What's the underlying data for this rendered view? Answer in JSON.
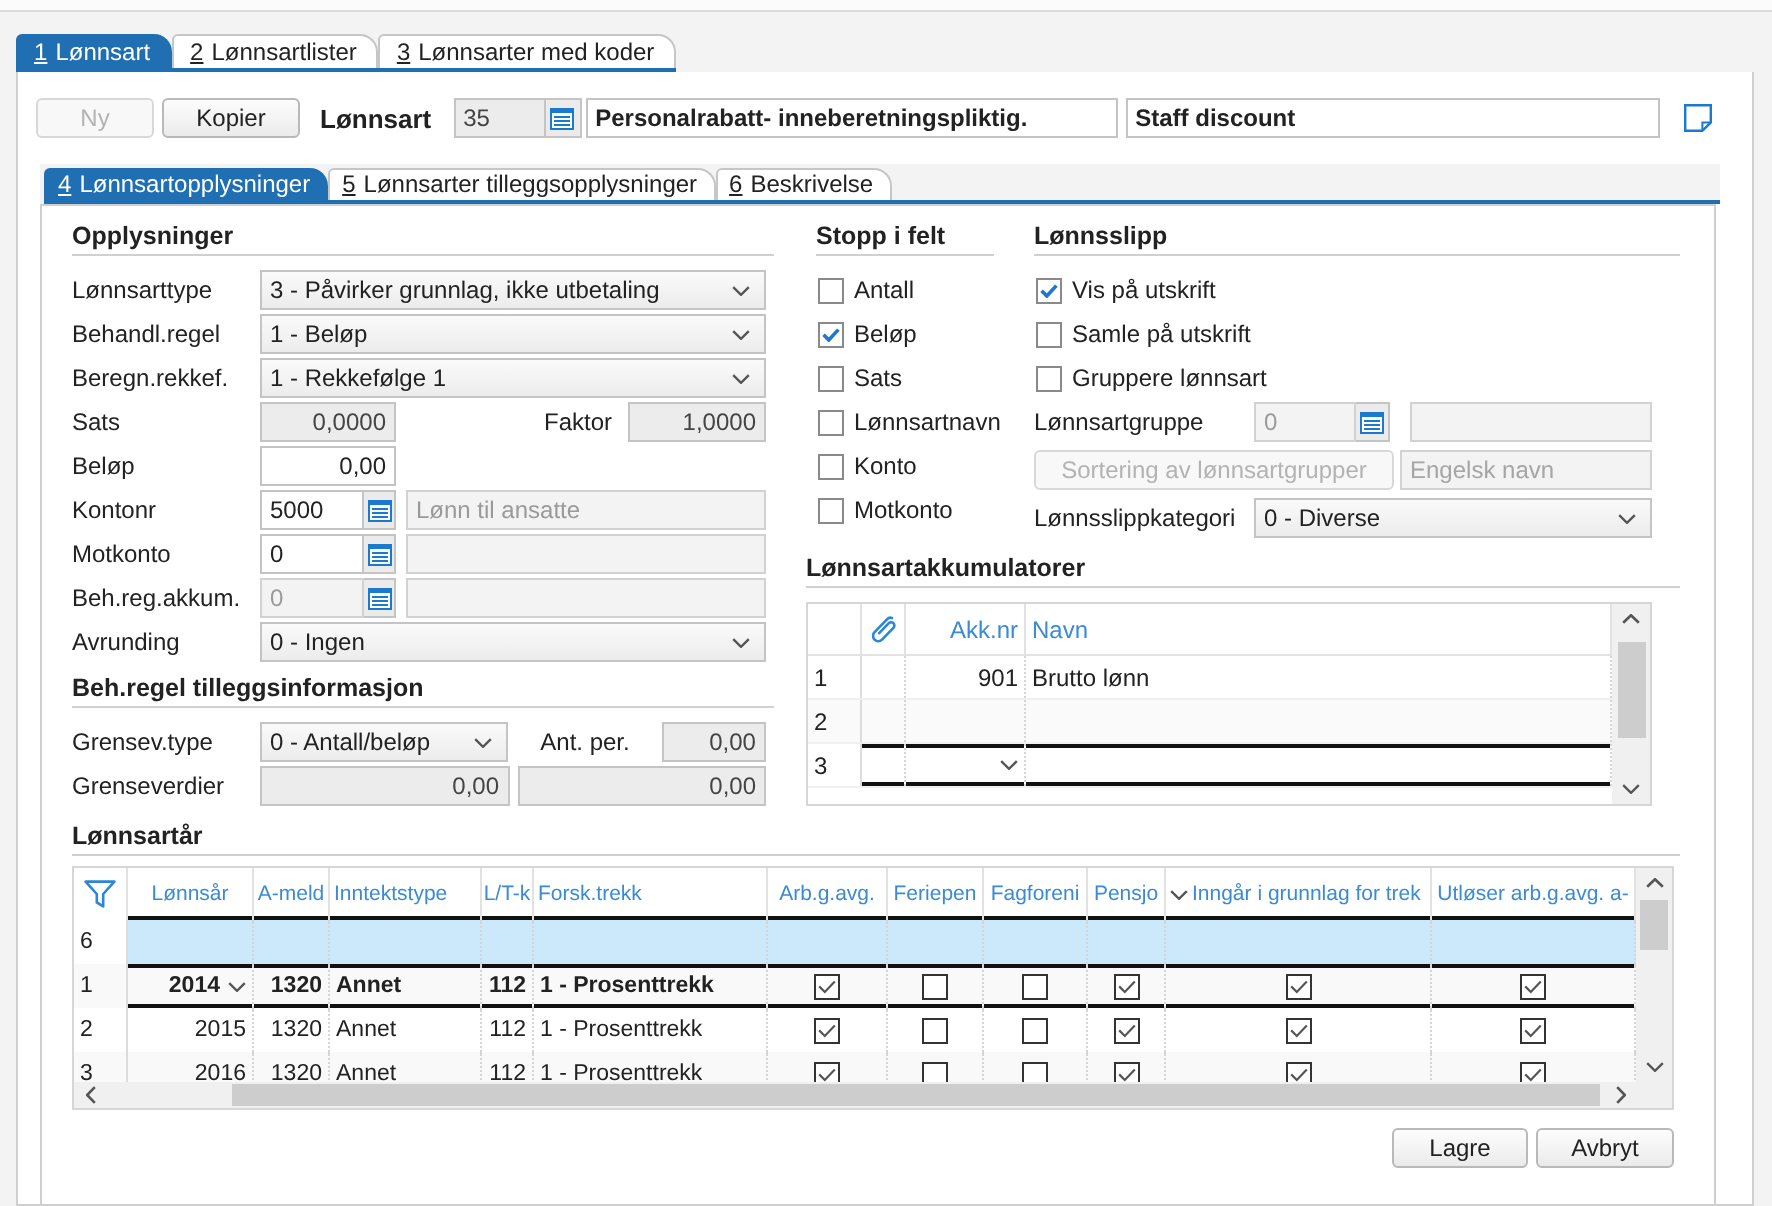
{
  "main_tabs": [
    {
      "key": "1",
      "label": "Lønnsart",
      "selected": true
    },
    {
      "key": "2",
      "label": "Lønnsartlister",
      "selected": false
    },
    {
      "key": "3",
      "label": "Lønnsarter med koder",
      "selected": false
    }
  ],
  "header": {
    "buttons": [
      {
        "label": "Ny",
        "disabled": true
      },
      {
        "label": "Kopier",
        "disabled": false
      }
    ],
    "label": "Lønnsart",
    "fields": [
      {
        "kind": "lookup",
        "value": "35",
        "readonly": true,
        "disabled": false
      },
      {
        "kind": "text",
        "value": "Personalrabatt- inneberetningspliktig.",
        "readonly": false,
        "disabled": false
      },
      {
        "kind": "text",
        "value": "Staff discount",
        "readonly": false,
        "disabled": false
      }
    ]
  },
  "sub_tabs": [
    {
      "key": "4",
      "label": "Lønnsartopplysninger",
      "selected": true
    },
    {
      "key": "5",
      "label": "Lønnsarter tilleggsopplysninger",
      "selected": false
    },
    {
      "key": "6",
      "label": "Beskrivelse",
      "selected": false
    }
  ],
  "sections": [
    {
      "title": "Opplysninger",
      "rows": [
        {
          "label": "Lønnsarttype",
          "controls": [
            {
              "kind": "select",
              "value": "3 - Påvirker grunnlag, ikke utbetaling"
            }
          ]
        },
        {
          "label": "Behandl.regel",
          "controls": [
            {
              "kind": "select",
              "value": "1 - Beløp"
            }
          ]
        },
        {
          "label": "Beregn.rekkef.",
          "controls": [
            {
              "kind": "select",
              "value": "1 - Rekkefølge 1"
            }
          ]
        },
        {
          "label": "Sats",
          "controls": [
            {
              "kind": "number",
              "value": "0,0000",
              "readonly": true,
              "disabled": false
            },
            {
              "kind": "label",
              "text": "Faktor"
            },
            {
              "kind": "number",
              "value": "1,0000",
              "readonly": true,
              "disabled": false
            }
          ]
        },
        {
          "label": "Beløp",
          "controls": [
            {
              "kind": "number",
              "value": "0,00",
              "readonly": false,
              "disabled": false
            }
          ]
        },
        {
          "label": "Kontonr",
          "controls": [
            {
              "kind": "lookup",
              "value": "5000",
              "readonly": false,
              "disabled": false
            },
            {
              "kind": "text",
              "value": "Lønn til ansatte",
              "readonly": false,
              "disabled": true
            }
          ]
        },
        {
          "label": "Motkonto",
          "controls": [
            {
              "kind": "lookup",
              "value": "0",
              "readonly": false,
              "disabled": false
            },
            {
              "kind": "text",
              "readonly": false,
              "disabled": true
            }
          ]
        },
        {
          "label": "Beh.reg.akkum.",
          "controls": [
            {
              "kind": "lookup",
              "value": "0",
              "readonly": false,
              "disabled": true
            },
            {
              "kind": "text",
              "readonly": false,
              "disabled": true
            }
          ]
        },
        {
          "label": "Avrunding",
          "controls": [
            {
              "kind": "select",
              "value": "0 - Ingen"
            }
          ]
        }
      ]
    },
    {
      "title": "Beh.regel tilleggsinformasjon",
      "rows": [
        {
          "label": "Grensev.type",
          "controls": [
            {
              "kind": "select",
              "value": "0 - Antall/beløp"
            },
            {
              "kind": "label",
              "text": "Ant. per."
            },
            {
              "kind": "number",
              "value": "0,00",
              "readonly": true,
              "disabled": false
            }
          ]
        },
        {
          "label": "Grenseverdier",
          "controls": [
            {
              "kind": "number",
              "value": "0,00",
              "readonly": true,
              "disabled": false
            },
            {
              "kind": "number",
              "value": "0,00",
              "readonly": true,
              "disabled": false
            }
          ]
        }
      ]
    }
  ],
  "stop_fields": {
    "title": "Stopp i felt",
    "items": [
      {
        "label": "Antall",
        "checked": false
      },
      {
        "label": "Beløp",
        "checked": true
      },
      {
        "label": "Sats",
        "checked": false
      },
      {
        "label": "Lønnsartnavn",
        "checked": false
      },
      {
        "label": "Konto",
        "checked": false
      },
      {
        "label": "Motkonto",
        "checked": false
      }
    ]
  },
  "payslip": {
    "title": "Lønnsslipp",
    "checkboxes": [
      {
        "label": "Vis på utskrift",
        "checked": true
      },
      {
        "label": "Samle på utskrift",
        "checked": false
      },
      {
        "label": "Gruppere lønnsart",
        "checked": false
      }
    ],
    "rows": [
      {
        "label": "Lønnsartgruppe",
        "controls": [
          {
            "kind": "lookup",
            "value": "0",
            "readonly": false,
            "disabled": true
          },
          {
            "kind": "text",
            "readonly": false,
            "disabled": true
          }
        ]
      },
      {
        "controls": [
          {
            "kind": "button",
            "label": "Sortering av lønnsartgrupper",
            "disabled": true
          },
          {
            "kind": "text",
            "placeholder": "Engelsk navn",
            "readonly": false,
            "disabled": true
          }
        ]
      },
      {
        "label": "Lønnsslippkategori",
        "controls": [
          {
            "kind": "select",
            "value": "0 - Diverse"
          }
        ]
      }
    ]
  },
  "accumulators": {
    "title": "Lønnsartakkumulatorer",
    "columns": [
      {
        "kind": "attachment"
      },
      {
        "kind": "number",
        "label": "Akk.nr"
      },
      {
        "kind": "text",
        "label": "Navn"
      }
    ],
    "rows": [
      {
        "row_number": "1",
        "values": [
          "901",
          "Brutto lønn"
        ],
        "editing": false
      },
      {
        "row_number": "2",
        "editing": false
      },
      {
        "row_number": "3",
        "editing": true
      }
    ]
  },
  "years": {
    "title": "Lønnsartår",
    "columns": [
      {
        "kind": "number",
        "label": "Lønnsår",
        "sorted": false
      },
      {
        "kind": "number",
        "label": "A-meld",
        "sorted": false
      },
      {
        "kind": "text",
        "label": "Inntektstype",
        "sorted": false
      },
      {
        "kind": "number",
        "label": "L/T-k",
        "sorted": false
      },
      {
        "kind": "text",
        "label": "Forsk.trekk",
        "sorted": false
      },
      {
        "kind": "check",
        "label": "Arb.g.avg.",
        "sorted": false
      },
      {
        "kind": "check",
        "label": "Feriepen",
        "sorted": false
      },
      {
        "kind": "check",
        "label": "Fagforeni",
        "sorted": false
      },
      {
        "kind": "check",
        "label": "Pensjo",
        "sorted": false
      },
      {
        "kind": "check",
        "label": "Inngår i grunnlag for trek",
        "sorted": true
      },
      {
        "kind": "check",
        "label": "Utløser arb.g.avg. a-",
        "sorted": false
      }
    ],
    "rows": [
      {
        "kind": "new",
        "row_number": "6",
        "selected": false
      },
      {
        "kind": "data",
        "row_number": "1",
        "selected": true,
        "values": [
          "2014",
          "1320",
          "Annet",
          "112",
          "1 - Prosenttrekk"
        ],
        "checked": [
          true,
          false,
          false,
          true,
          true,
          true
        ]
      },
      {
        "kind": "data",
        "row_number": "2",
        "selected": false,
        "values": [
          "2015",
          "1320",
          "Annet",
          "112",
          "1 - Prosenttrekk"
        ],
        "checked": [
          true,
          false,
          false,
          true,
          true,
          true
        ]
      },
      {
        "kind": "data",
        "row_number": "3",
        "selected": false,
        "values": [
          "2016",
          "1320",
          "Annet",
          "112",
          "1 - Prosenttrekk"
        ],
        "checked": [
          true,
          false,
          false,
          true,
          true,
          true
        ]
      }
    ]
  },
  "footer_buttons": [
    {
      "label": "Lagre"
    },
    {
      "label": "Avbryt"
    }
  ]
}
